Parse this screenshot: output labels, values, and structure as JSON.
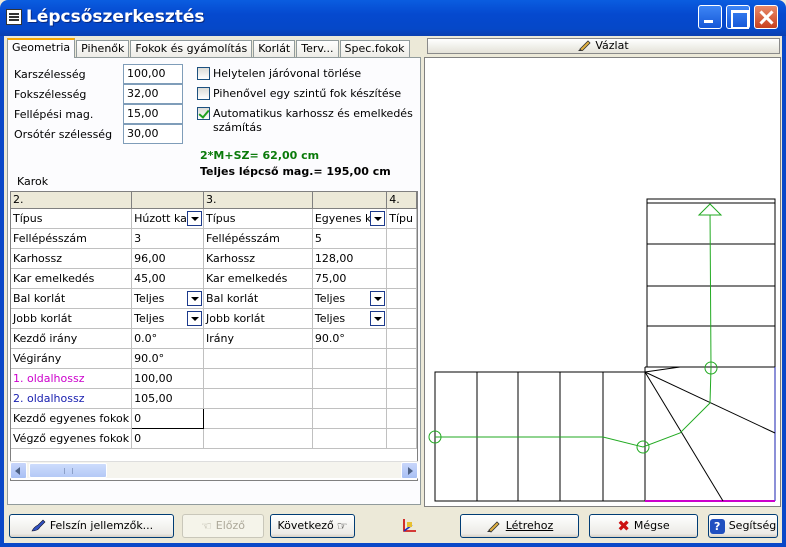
{
  "window": {
    "title": "Lépcsőszerkesztés"
  },
  "tabs": [
    {
      "label": "Geometria",
      "active": true
    },
    {
      "label": "Pihenők"
    },
    {
      "label": "Fokok és gyámolítás"
    },
    {
      "label": "Korlát"
    },
    {
      "label": "Terv..."
    },
    {
      "label": "Spec.fokok"
    }
  ],
  "geometry": {
    "fields": [
      {
        "label": "Karszélesség",
        "value": "100,00"
      },
      {
        "label": "Fokszélesség",
        "value": "32,00"
      },
      {
        "label": "Fellépési mag.",
        "value": "15,00"
      },
      {
        "label": "Orsótér szélesség",
        "value": "30,00"
      }
    ],
    "checks": [
      {
        "label": "Helytelen járóvonal törlése",
        "checked": false
      },
      {
        "label": "Pihenővel egy szintű fok készítése",
        "checked": false
      },
      {
        "label": "Automatikus karhossz és emelkedés",
        "label2": "számítás",
        "checked": true
      }
    ],
    "formula": "2*M+SZ= 62,00 cm",
    "total_height": "Teljes lépcső mag.= 195,00 cm",
    "karok_label": "Karok"
  },
  "grid": {
    "headers": [
      "2.",
      "",
      "3.",
      "",
      "4."
    ],
    "rows": [
      [
        "Típus",
        "Húzott kar",
        "Típus",
        "Egyenes kar",
        "Típu"
      ],
      [
        "Fellépésszám",
        "3",
        "Fellépésszám",
        "5",
        ""
      ],
      [
        "Karhossz",
        "96,00",
        "Karhossz",
        "128,00",
        ""
      ],
      [
        "Kar emelkedés",
        "45,00",
        "Kar emelkedés",
        "75,00",
        ""
      ],
      [
        "Bal korlát",
        "Teljes",
        "Bal korlát",
        "Teljes",
        ""
      ],
      [
        "Jobb korlát",
        "Teljes",
        "Jobb korlát",
        "Teljes",
        ""
      ],
      [
        "Kezdő irány",
        "0.0°",
        "Irány",
        "90.0°",
        ""
      ],
      [
        "Végirány",
        "90.0°",
        "",
        "",
        ""
      ],
      [
        "1. oldalhossz",
        "100,00",
        "",
        "",
        ""
      ],
      [
        "2. oldalhossz",
        "105,00",
        "",
        "",
        ""
      ],
      [
        "Kezdő egyenes fokok",
        "0",
        "",
        "",
        ""
      ],
      [
        "Végző egyenes fokok",
        "0",
        "",
        "",
        ""
      ]
    ]
  },
  "sketch": {
    "button_label": "Vázlat"
  },
  "buttons": {
    "surface": "Felszín jellemzők...",
    "prev": "Előző",
    "next": "Következő",
    "create": "Létrehoz",
    "cancel": "Mégse",
    "help": "Segítség"
  },
  "colors": {
    "titlebar": "#0549cf",
    "walkline": "#22aa22",
    "magenta_label": "#cc00cc",
    "blue_label": "#1a20b0",
    "formula_green": "#0a7a0a"
  }
}
